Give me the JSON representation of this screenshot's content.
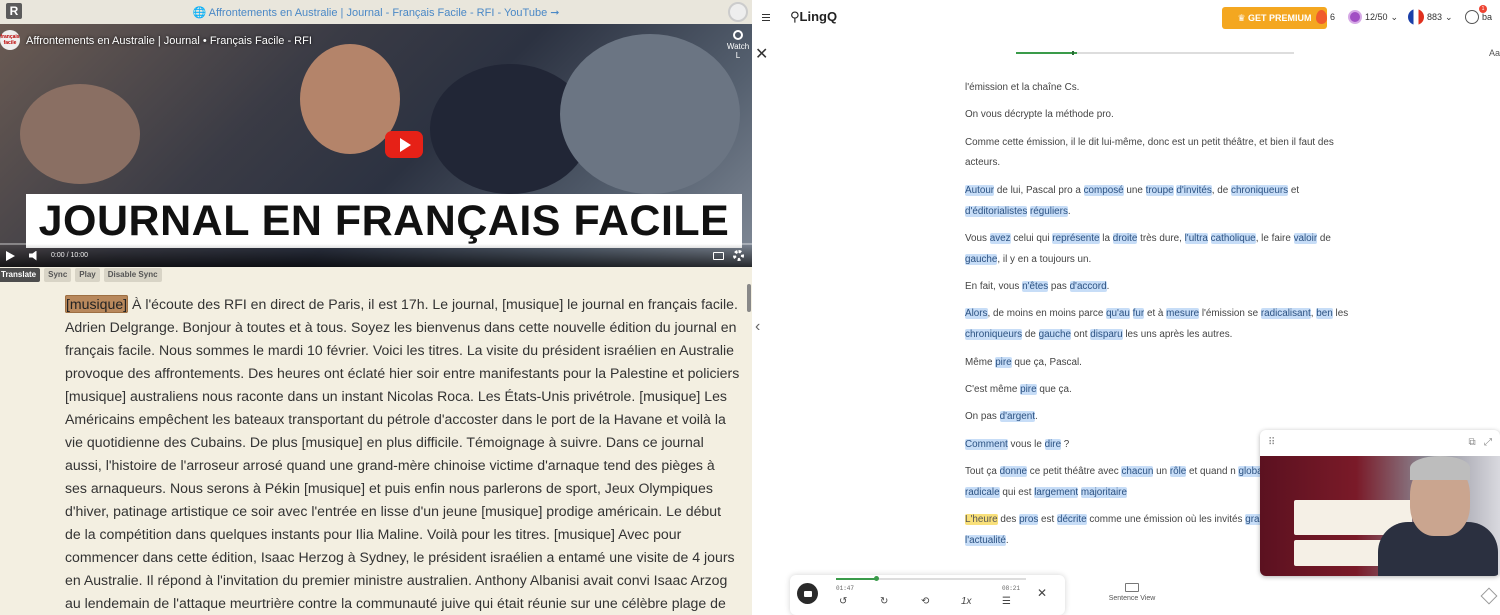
{
  "left_panel": {
    "r_button": "R",
    "top_link": "🌐 Affrontements en Australie | Journal - Français Facile - RFI - YouTube ➞",
    "video": {
      "title": "Affrontements en Australie | Journal • Français Facile - RFI",
      "channel_logo": "français facile",
      "watch_later": "Watch L",
      "banner": "JOURNAL EN FRANÇAIS FACILE",
      "time": "0:00 / 10:00",
      "progress": 0
    },
    "toolbar": {
      "translate": "Translate",
      "sync": "Sync",
      "play": "Play",
      "disable_sync": "Disable Sync"
    },
    "transcript": {
      "highlighted_word": "[musique]",
      "text": "À l'écoute des RFI en direct de Paris, il est 17h. Le journal, [musique] le journal en français facile. Adrien Delgrange. Bonjour à toutes et à tous. Soyez les bienvenus dans cette nouvelle édition du journal en français facile. Nous sommes le mardi 10 février. Voici les titres. La visite du président israélien en Australie provoque des affrontements. Des heures ont éclaté hier soir entre manifestants pour la Palestine et policiers [musique] australiens nous raconte dans un instant Nicolas Roca. Les États-Unis privétrole. [musique] Les Américains empêchent les bateaux transportant du pétrole d'accoster dans le port de la Havane et voilà la vie quotidienne des Cubains. De plus [musique] en plus difficile. Témoignage à suivre. Dans ce journal aussi, l'histoire de l'arroseur arrosé quand une grand-mère chinoise victime d'arnaque tend des pièges à ses arnaqueurs. Nous serons à Pékin [musique] et puis enfin nous parlerons de sport, Jeux Olympiques d'hiver, patinage artistique ce soir avec l'entrée en lisse d'un jeune [musique] prodige américain. Le début de la compétition dans quelques instants pour Ilia Maline. Voilà pour les titres. [musique] Avec pour commencer dans cette édition, Isaac Herzog à Sydney, le président israélien a entamé une visite de 4 jours en Australie. Il répond à l'invitation du premier ministre australien. Anthony Albanisi avait convi Isaac Arzog au lendemain de l'attaque meurtrière contre la communauté juive qui était réunie sur une célèbre plage de Sydney le 14"
    }
  },
  "right_panel": {
    "logo": "LingQ",
    "premium": "♛ GET PREMIUM",
    "streak": "6",
    "coins": "12/50",
    "known_words": "883",
    "user": "ba",
    "notif": "1",
    "close": "✕",
    "font_btn": "Aa",
    "lesson_progress": 0.22,
    "lesson_progress_mark": 0.2,
    "back_arrow": "‹",
    "paragraphs": [
      [
        [
          "t",
          "l'émission et la chaîne Cs."
        ]
      ],
      [
        [
          "t",
          "On vous décrypte la méthode pro."
        ]
      ],
      [
        [
          "t",
          "Comme cette émission, il le dit lui-même, donc est un petit théâtre, et bien il faut des acteurs."
        ]
      ],
      [
        [
          "w",
          "Autour"
        ],
        [
          "t",
          " de lui, Pascal pro a "
        ],
        [
          "w",
          "composé"
        ],
        [
          "t",
          " une "
        ],
        [
          "w",
          "troupe"
        ],
        [
          "t",
          " "
        ],
        [
          "w",
          "d'invités"
        ],
        [
          "t",
          ", de "
        ],
        [
          "w",
          "chroniqueurs"
        ],
        [
          "t",
          " et "
        ],
        [
          "w",
          "d'éditorialistes"
        ],
        [
          "t",
          " "
        ],
        [
          "w",
          "réguliers"
        ],
        [
          "t",
          "."
        ]
      ],
      [
        [
          "t",
          "Vous "
        ],
        [
          "w",
          "avez"
        ],
        [
          "t",
          " celui qui "
        ],
        [
          "w",
          "représente"
        ],
        [
          "t",
          " la "
        ],
        [
          "w",
          "droite"
        ],
        [
          "t",
          " très dure, "
        ],
        [
          "w",
          "l'ultra"
        ],
        [
          "t",
          " "
        ],
        [
          "w",
          "catholique"
        ],
        [
          "t",
          ", le faire "
        ],
        [
          "w",
          "valoir"
        ],
        [
          "t",
          " de "
        ],
        [
          "w",
          "gauche"
        ],
        [
          "t",
          ", il y en a toujours un."
        ]
      ],
      [
        [
          "t",
          "En fait, vous "
        ],
        [
          "w",
          "n'êtes"
        ],
        [
          "t",
          " pas "
        ],
        [
          "w",
          "d'accord"
        ],
        [
          "t",
          "."
        ]
      ],
      [
        [
          "w",
          "Alors"
        ],
        [
          "t",
          ", de moins en moins parce "
        ],
        [
          "w",
          "qu'au"
        ],
        [
          "t",
          " "
        ],
        [
          "w",
          "fur"
        ],
        [
          "t",
          " et à "
        ],
        [
          "w",
          "mesure"
        ],
        [
          "t",
          " l'émission se "
        ],
        [
          "w",
          "radicalisant"
        ],
        [
          "t",
          ", "
        ],
        [
          "w",
          "ben"
        ],
        [
          "t",
          " les "
        ],
        [
          "w",
          "chroniqueurs"
        ],
        [
          "t",
          " de "
        ],
        [
          "w",
          "gauche"
        ],
        [
          "t",
          " ont "
        ],
        [
          "w",
          "disparu"
        ],
        [
          "t",
          " les uns après les autres."
        ]
      ],
      [
        [
          "t",
          "Même "
        ],
        [
          "w",
          "pire"
        ],
        [
          "t",
          " que ça, Pascal."
        ]
      ],
      [
        [
          "t",
          "C'est même "
        ],
        [
          "w",
          "pire"
        ],
        [
          "t",
          " que ça."
        ]
      ],
      [
        [
          "t",
          "On pas "
        ],
        [
          "w",
          "d'argent"
        ],
        [
          "t",
          "."
        ]
      ],
      [
        [
          "w",
          "Comment"
        ],
        [
          "t",
          " vous le "
        ],
        [
          "w",
          "dire"
        ],
        [
          "t",
          " ?"
        ]
      ],
      [
        [
          "t",
          "Tout ça "
        ],
        [
          "w",
          "donne"
        ],
        [
          "t",
          " ce petit théâtre avec "
        ],
        [
          "w",
          "chacun"
        ],
        [
          "t",
          " un "
        ],
        [
          "w",
          "rôle"
        ],
        [
          "t",
          " et quand n "
        ],
        [
          "w",
          "globale"
        ],
        [
          "t",
          " qui reste la "
        ],
        [
          "w",
          "droite"
        ],
        [
          "t",
          " "
        ],
        [
          "w",
          "radicale"
        ],
        [
          "t",
          " qui est "
        ],
        [
          "w",
          "largement"
        ],
        [
          "t",
          " "
        ],
        [
          "w",
          "majoritaire"
        ]
      ],
      [
        [
          "y",
          "L'heure"
        ],
        [
          "t",
          " des "
        ],
        [
          "w",
          "pros"
        ],
        [
          "t",
          " est "
        ],
        [
          "w",
          "décrite"
        ],
        [
          "t",
          " comme une émission où les invités "
        ],
        [
          "w",
          "grands"
        ],
        [
          "t",
          " "
        ],
        [
          "w",
          "thèmes"
        ],
        [
          "t",
          " de "
        ],
        [
          "w",
          "l'actualité"
        ],
        [
          "t",
          "."
        ]
      ]
    ],
    "player": {
      "current": "01:47",
      "total": "08:21",
      "progress": 0.213,
      "rewind": "↺",
      "forward": "↻",
      "loop": "⟲",
      "speed": "1x",
      "list": "☰",
      "close": "✕"
    },
    "sentence_view": "Sentence View",
    "mini_player": {
      "drag": "⠿",
      "pip": "⧉",
      "expand": "⤢"
    }
  }
}
